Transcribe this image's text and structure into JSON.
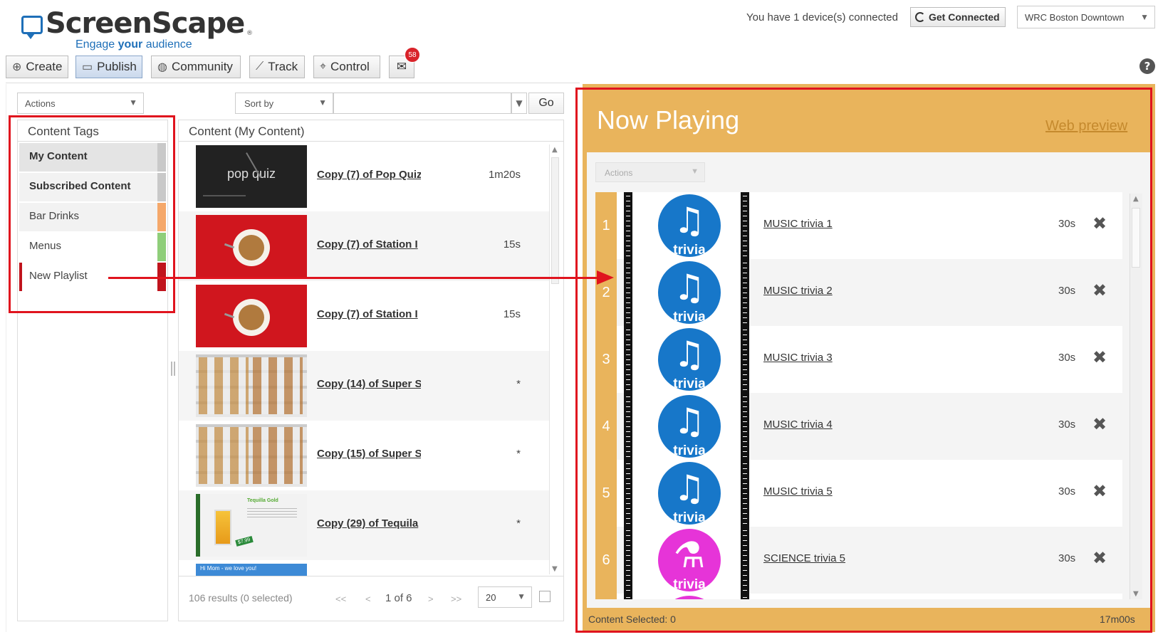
{
  "logo": {
    "name": "ScreenScape",
    "tagline_pre": "Engage ",
    "tagline_bold": "your",
    "tagline_post": " audience",
    "reg": "®"
  },
  "header": {
    "devices_text": "You have 1 device(s) connected",
    "get_connected_label": "Get Connected",
    "location": "WRC Boston Downtown"
  },
  "nav": {
    "create": "Create",
    "publish": "Publish",
    "community": "Community",
    "track": "Track",
    "control": "Control",
    "mail_count": "58",
    "active": "Publish"
  },
  "toolbar": {
    "actions_label": "Actions",
    "sort_label": "Sort by",
    "search_value": "",
    "go_label": "Go"
  },
  "tags": {
    "title": "Content Tags",
    "items": [
      {
        "label": "My Content",
        "color": "#c9c9c9"
      },
      {
        "label": "Subscribed Content",
        "color": "#c9c9c9"
      },
      {
        "label": "Bar Drinks",
        "color": "#f5a86a"
      },
      {
        "label": "Menus",
        "color": "#8fce7a"
      },
      {
        "label": "New Playlist",
        "color": "#c0141d"
      }
    ]
  },
  "content": {
    "title": "Content (My Content)",
    "items": [
      {
        "name": "Copy (7) of Pop Quiz",
        "duration": "1m20s",
        "thumb": "pop-quiz",
        "thumb_text": "pop quiz"
      },
      {
        "name": "Copy (7) of Station I",
        "duration": "15s",
        "thumb": "coffee"
      },
      {
        "name": "Copy (7) of Station I",
        "duration": "15s",
        "thumb": "coffee"
      },
      {
        "name": "Copy (14) of Super S",
        "duration": "*",
        "thumb": "menu-grid"
      },
      {
        "name": "Copy (15) of Super S",
        "duration": "*",
        "thumb": "menu-grid"
      },
      {
        "name": "Copy (29) of Tequila",
        "duration": "*",
        "thumb": "tequila",
        "thumb_text": "Tequilla Gold",
        "price": "$7.99"
      },
      {
        "name": "",
        "duration": "",
        "thumb": "banner",
        "thumb_text": "Hi Mom - we love you!"
      }
    ],
    "results_text": "106 results (0 selected)",
    "pager": {
      "first": "<<",
      "prev": "<",
      "info": "1 of 6",
      "next": ">",
      "last": ">>"
    },
    "page_size": "20"
  },
  "now_playing": {
    "title": "Now Playing",
    "web_preview": "Web preview",
    "actions_label": "Actions",
    "items": [
      {
        "index": "1",
        "name": "MUSIC trivia 1",
        "duration": "30s",
        "kind": "music",
        "badge": "trivia"
      },
      {
        "index": "2",
        "name": "MUSIC trivia 2",
        "duration": "30s",
        "kind": "music",
        "badge": "trivia"
      },
      {
        "index": "3",
        "name": "MUSIC trivia 3",
        "duration": "30s",
        "kind": "music",
        "badge": "trivia"
      },
      {
        "index": "4",
        "name": "MUSIC trivia 4",
        "duration": "30s",
        "kind": "music",
        "badge": "trivia"
      },
      {
        "index": "5",
        "name": "MUSIC trivia 5",
        "duration": "30s",
        "kind": "music",
        "badge": "trivia"
      },
      {
        "index": "6",
        "name": "SCIENCE trivia 5",
        "duration": "30s",
        "kind": "science",
        "badge": "trivia"
      }
    ],
    "content_selected": "Content Selected: 0",
    "total_duration": "17m00s"
  },
  "colors": {
    "accent": "#e9b45c",
    "brand_blue": "#1e6fb8",
    "music": "#1777c9",
    "science": "#e634d8",
    "annotation": "#e0141e"
  }
}
